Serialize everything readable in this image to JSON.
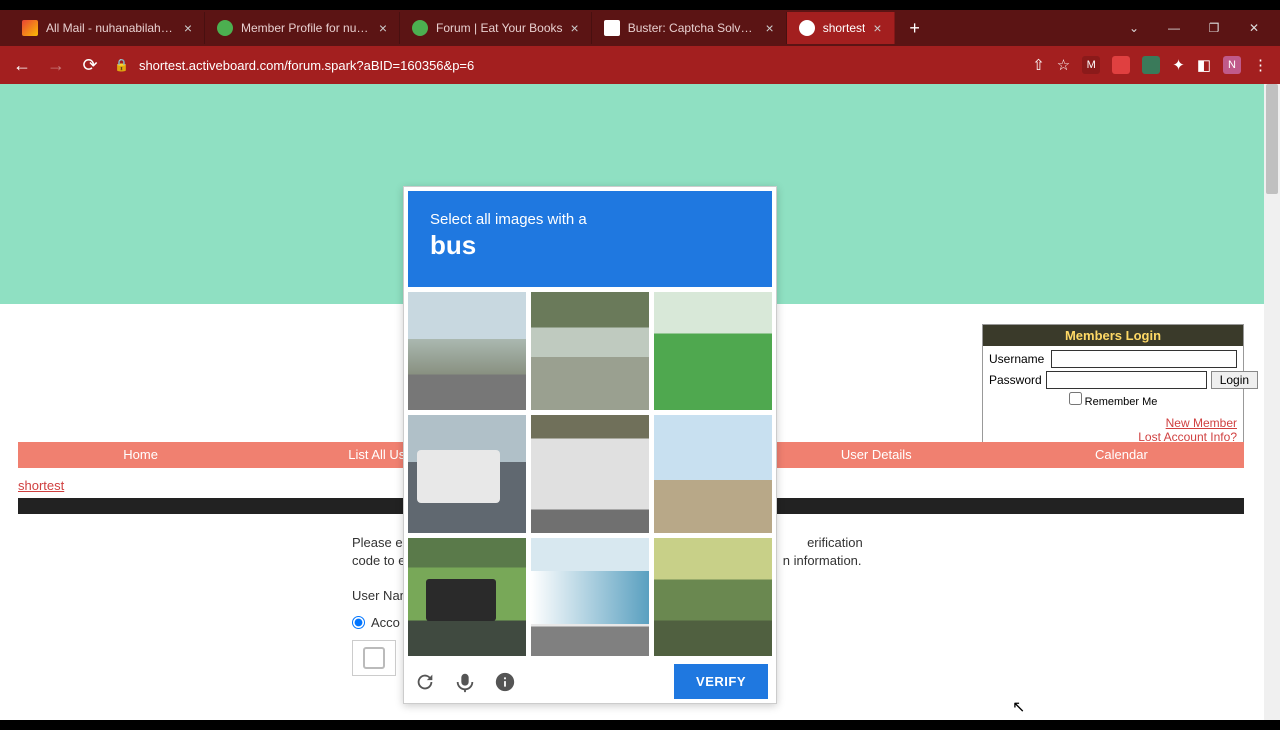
{
  "browser": {
    "tabs": [
      {
        "title": "All Mail - nuhanabilahhaik@"
      },
      {
        "title": "Member Profile for nuhanab"
      },
      {
        "title": "Forum | Eat Your Books"
      },
      {
        "title": "Buster: Captcha Solver for H"
      },
      {
        "title": "shortest"
      }
    ],
    "url": "shortest.activeboard.com/forum.spark?aBID=160356&p=6",
    "window": {
      "min": "—",
      "max": "❐",
      "close": "✕",
      "dropdown": "⌄"
    }
  },
  "login": {
    "header": "Members Login",
    "user_label": "Username",
    "pass_label": "Password",
    "button": "Login",
    "remember": "Remember Me",
    "new_member": "New Member",
    "lost": "Lost Account Info?"
  },
  "mainnav": [
    "Home",
    "List All Users",
    "",
    "User Details",
    "Calendar"
  ],
  "breadcrumb": "shortest",
  "form": {
    "line1": "Please en",
    "line1b": "erification",
    "line2": "code to e",
    "line2b": "n information.",
    "user_name": "User Nam",
    "acco": "Acco"
  },
  "recaptcha": {
    "prompt_small": "Select all images with a",
    "prompt_big": "bus",
    "verify": "VERIFY"
  }
}
